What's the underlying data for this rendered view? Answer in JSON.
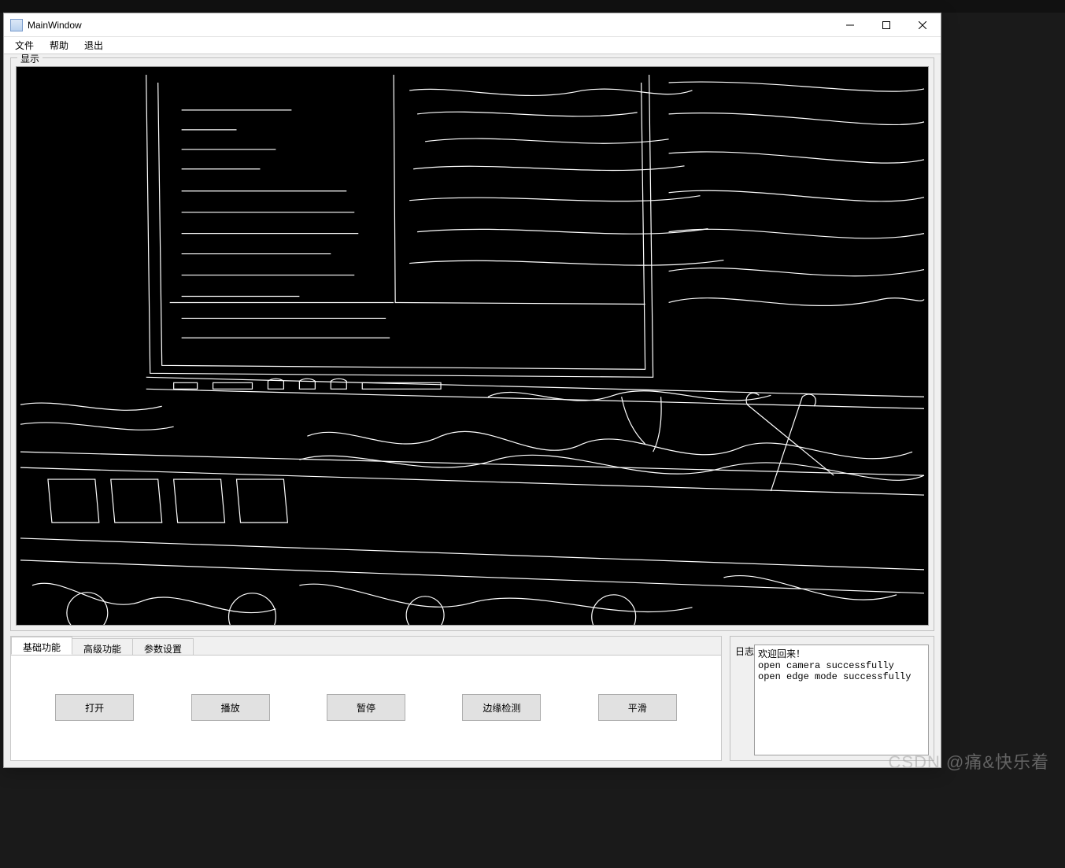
{
  "top_bar_hint": "",
  "window": {
    "title": "MainWindow"
  },
  "menubar": {
    "items": [
      "文件",
      "帮助",
      "退出"
    ]
  },
  "display_group": {
    "legend": "显示"
  },
  "tabs": {
    "items": [
      {
        "label": "基础功能",
        "active": true
      },
      {
        "label": "高级功能",
        "active": false
      },
      {
        "label": "参数设置",
        "active": false
      }
    ],
    "basic_buttons": {
      "open": "打开",
      "play": "播放",
      "pause": "暂停",
      "edge": "边缘检测",
      "smooth": "平滑"
    }
  },
  "log": {
    "legend": "日志",
    "lines": [
      "欢迎回来！",
      "open camera successfully",
      "open edge mode successfully"
    ]
  },
  "watermark": "CSDN @痛&快乐着"
}
